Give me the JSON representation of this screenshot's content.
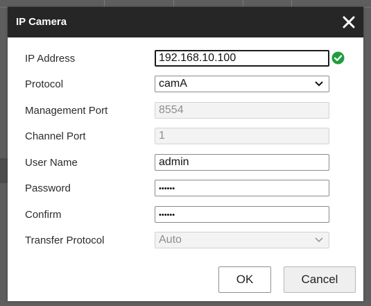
{
  "dialog": {
    "title": "IP Camera",
    "fields": {
      "ip_address": {
        "label": "IP Address",
        "value": "192.168.10.100",
        "valid": true
      },
      "protocol": {
        "label": "Protocol",
        "value": "camA"
      },
      "management_port": {
        "label": "Management Port",
        "value": "8554"
      },
      "channel_port": {
        "label": "Channel Port",
        "value": "1"
      },
      "user_name": {
        "label": "User Name",
        "value": "admin"
      },
      "password": {
        "label": "Password",
        "masked": "••••••"
      },
      "confirm": {
        "label": "Confirm",
        "masked": "••••••"
      },
      "transfer_protocol": {
        "label": "Transfer Protocol",
        "value": "Auto"
      }
    },
    "buttons": {
      "ok": "OK",
      "cancel": "Cancel"
    }
  },
  "colors": {
    "titlebar": "#262626",
    "valid_check": "#1e9e3e",
    "backdrop": "#5e5e5e"
  },
  "icons": {
    "close": "close-icon",
    "valid": "checkmark-circle-icon",
    "dropdown": "chevron-down-icon"
  }
}
